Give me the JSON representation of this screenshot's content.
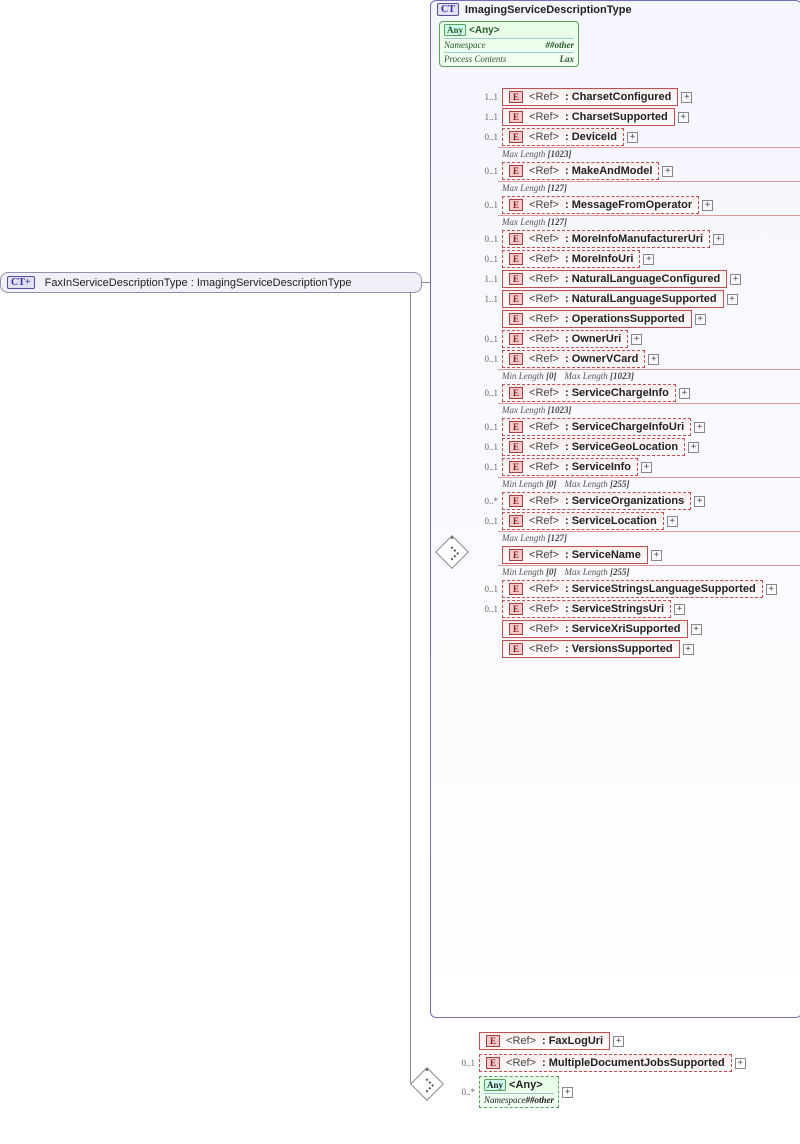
{
  "root": {
    "label": "FaxInServiceDescriptionType : ImagingServiceDescriptionType"
  },
  "ct": {
    "title": "ImagingServiceDescriptionType",
    "any": {
      "label": "<Any>",
      "kv": [
        {
          "k": "Namespace",
          "v": "##other"
        },
        {
          "k": "Process Contents",
          "v": "Lax"
        }
      ]
    },
    "elements": [
      {
        "occurs": "1..1",
        "name": "CharsetConfigured",
        "dashed": false,
        "expand": true
      },
      {
        "occurs": "1..1",
        "name": "CharsetSupported",
        "dashed": false,
        "expand": true
      },
      {
        "occurs": "0..1",
        "name": "DeviceId",
        "dashed": true,
        "expand": true,
        "meta": [
          {
            "k": "Max Length",
            "v": "[1023]"
          }
        ]
      },
      {
        "occurs": "0..1",
        "name": "MakeAndModel",
        "dashed": true,
        "expand": true,
        "meta": [
          {
            "k": "Max Length",
            "v": "[127]"
          }
        ]
      },
      {
        "occurs": "0..1",
        "name": "MessageFromOperator",
        "dashed": true,
        "expand": true,
        "meta": [
          {
            "k": "Max Length",
            "v": "[127]"
          }
        ]
      },
      {
        "occurs": "0..1",
        "name": "MoreInfoManufacturerUri",
        "dashed": true,
        "expand": true
      },
      {
        "occurs": "0..1",
        "name": "MoreInfoUri",
        "dashed": true,
        "expand": true
      },
      {
        "occurs": "1..1",
        "name": "NaturalLanguageConfigured",
        "dashed": false,
        "expand": true
      },
      {
        "occurs": "1..1",
        "name": "NaturalLanguageSupported",
        "dashed": false,
        "expand": true
      },
      {
        "occurs": "",
        "name": "OperationsSupported",
        "dashed": false,
        "expand": true
      },
      {
        "occurs": "0..1",
        "name": "OwnerUri",
        "dashed": true,
        "expand": true
      },
      {
        "occurs": "0..1",
        "name": "OwnerVCard",
        "dashed": true,
        "expand": true,
        "meta": [
          {
            "k": "Min Length",
            "v": "[0]"
          },
          {
            "k": "Max Length",
            "v": "[1023]"
          }
        ]
      },
      {
        "occurs": "0..1",
        "name": "ServiceChargeInfo",
        "dashed": true,
        "expand": true,
        "meta": [
          {
            "k": "Max Length",
            "v": "[1023]"
          }
        ]
      },
      {
        "occurs": "0..1",
        "name": "ServiceChargeInfoUri",
        "dashed": true,
        "expand": true
      },
      {
        "occurs": "0..1",
        "name": "ServiceGeoLocation",
        "dashed": true,
        "expand": true
      },
      {
        "occurs": "0..1",
        "name": "ServiceInfo",
        "dashed": true,
        "expand": true,
        "meta": [
          {
            "k": "Min Length",
            "v": "[0]"
          },
          {
            "k": "Max Length",
            "v": "[255]"
          }
        ]
      },
      {
        "occurs": "0..*",
        "name": "ServiceOrganizations",
        "dashed": true,
        "expand": true
      },
      {
        "occurs": "0..1",
        "name": "ServiceLocation",
        "dashed": true,
        "expand": true,
        "meta": [
          {
            "k": "Max Length",
            "v": "[127]"
          }
        ]
      },
      {
        "occurs": "",
        "name": "ServiceName",
        "dashed": false,
        "expand": true,
        "meta": [
          {
            "k": "Min Length",
            "v": "[0]"
          },
          {
            "k": "Max Length",
            "v": "[255]"
          }
        ]
      },
      {
        "occurs": "0..1",
        "name": "ServiceStringsLanguageSupported",
        "dashed": true,
        "expand": true
      },
      {
        "occurs": "0..1",
        "name": "ServiceStringsUri",
        "dashed": true,
        "expand": true
      },
      {
        "occurs": "",
        "name": "ServiceXriSupported",
        "dashed": false,
        "expand": true
      },
      {
        "occurs": "",
        "name": "VersionsSupported",
        "dashed": false,
        "expand": true
      }
    ]
  },
  "ext": {
    "elements": [
      {
        "occurs": "",
        "name": "FaxLogUri",
        "dashed": false,
        "expand": true
      },
      {
        "occurs": "0..1",
        "name": "MultipleDocumentJobsSupported",
        "dashed": true,
        "expand": true
      }
    ],
    "any": {
      "occurs": "0..*",
      "namespace": "##other"
    }
  }
}
